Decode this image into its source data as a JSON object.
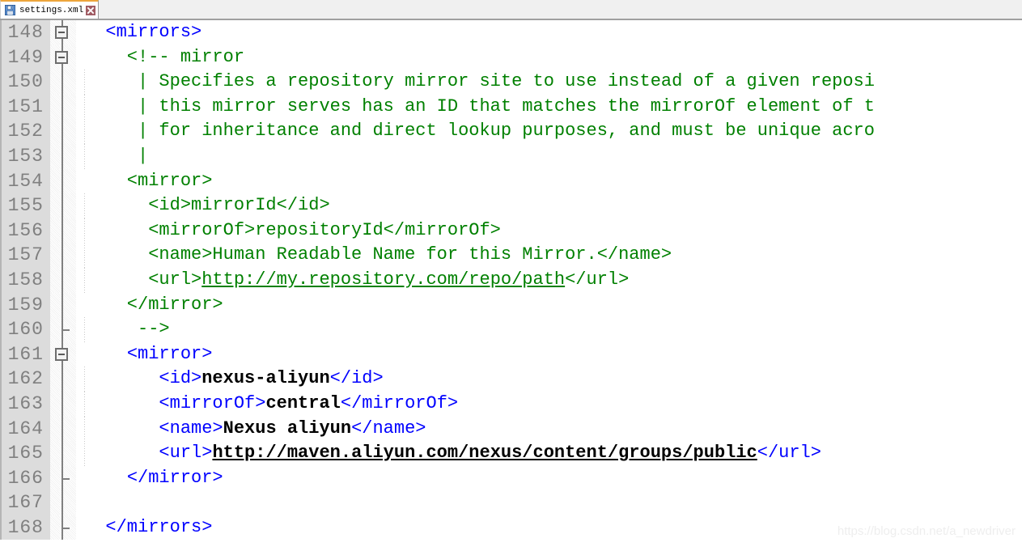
{
  "window": {
    "title": "settings.xml"
  },
  "tab": {
    "label": "settings.xml",
    "save_icon": "floppy-disk-save-icon",
    "close_icon": "close-x-icon",
    "accent_color": "#eda53c",
    "active": true
  },
  "editor": {
    "language": "xml",
    "first_visible_line": 148,
    "last_visible_line": 168,
    "colors": {
      "comment": "#008000",
      "tag": "#0000ff",
      "value": "#000000",
      "gutter_bg": "#dcdcdc",
      "gutter_fg": "#808080",
      "background": "#ffffff"
    },
    "lines": [
      {
        "number": "148",
        "fold": "box",
        "indent_guide": false,
        "tokens": [
          {
            "t": "  ",
            "c": "plain"
          },
          {
            "t": "<mirrors>",
            "c": "tag"
          }
        ]
      },
      {
        "number": "149",
        "fold": "box",
        "indent_guide": false,
        "tokens": [
          {
            "t": "    <!-- mirror",
            "c": "cmt"
          }
        ]
      },
      {
        "number": "150",
        "fold": "line",
        "indent_guide": true,
        "tokens": [
          {
            "t": "     | Specifies a repository mirror site to use instead of a given reposi",
            "c": "cmt"
          }
        ]
      },
      {
        "number": "151",
        "fold": "line",
        "indent_guide": true,
        "tokens": [
          {
            "t": "     | this mirror serves has an ID that matches the mirrorOf element of t",
            "c": "cmt"
          }
        ]
      },
      {
        "number": "152",
        "fold": "line",
        "indent_guide": true,
        "tokens": [
          {
            "t": "     | for inheritance and direct lookup purposes, and must be unique acro",
            "c": "cmt"
          }
        ]
      },
      {
        "number": "153",
        "fold": "line",
        "indent_guide": true,
        "tokens": [
          {
            "t": "     |",
            "c": "cmt"
          }
        ]
      },
      {
        "number": "154",
        "fold": "line",
        "indent_guide": false,
        "tokens": [
          {
            "t": "    <mirror>",
            "c": "cmt"
          }
        ]
      },
      {
        "number": "155",
        "fold": "line",
        "indent_guide": true,
        "tokens": [
          {
            "t": "      <id>mirrorId</id>",
            "c": "cmt"
          }
        ]
      },
      {
        "number": "156",
        "fold": "line",
        "indent_guide": true,
        "tokens": [
          {
            "t": "      <mirrorOf>repositoryId</mirrorOf>",
            "c": "cmt"
          }
        ]
      },
      {
        "number": "157",
        "fold": "line",
        "indent_guide": true,
        "tokens": [
          {
            "t": "      <name>Human Readable Name for this Mirror.</name>",
            "c": "cmt"
          }
        ]
      },
      {
        "number": "158",
        "fold": "line",
        "indent_guide": true,
        "tokens": [
          {
            "t": "      <url>",
            "c": "cmt"
          },
          {
            "t": "http://my.repository.com/repo/path",
            "c": "cmt-u"
          },
          {
            "t": "</url>",
            "c": "cmt"
          }
        ]
      },
      {
        "number": "159",
        "fold": "line",
        "indent_guide": false,
        "tokens": [
          {
            "t": "    </mirror>",
            "c": "cmt"
          }
        ]
      },
      {
        "number": "160",
        "fold": "endtick",
        "indent_guide": true,
        "tokens": [
          {
            "t": "     -->",
            "c": "cmt"
          }
        ]
      },
      {
        "number": "161",
        "fold": "box",
        "indent_guide": false,
        "tokens": [
          {
            "t": "    ",
            "c": "plain"
          },
          {
            "t": "<mirror>",
            "c": "tag"
          }
        ]
      },
      {
        "number": "162",
        "fold": "line",
        "indent_guide": true,
        "tokens": [
          {
            "t": "       ",
            "c": "plain"
          },
          {
            "t": "<id>",
            "c": "tag"
          },
          {
            "t": "nexus-aliyun",
            "c": "val"
          },
          {
            "t": "</id>",
            "c": "tag"
          }
        ]
      },
      {
        "number": "163",
        "fold": "line",
        "indent_guide": true,
        "tokens": [
          {
            "t": "       ",
            "c": "plain"
          },
          {
            "t": "<mirrorOf>",
            "c": "tag"
          },
          {
            "t": "central",
            "c": "val"
          },
          {
            "t": "</mirrorOf>",
            "c": "tag"
          }
        ]
      },
      {
        "number": "164",
        "fold": "line",
        "indent_guide": true,
        "tokens": [
          {
            "t": "       ",
            "c": "plain"
          },
          {
            "t": "<name>",
            "c": "tag"
          },
          {
            "t": "Nexus aliyun",
            "c": "val"
          },
          {
            "t": "</name>",
            "c": "tag"
          }
        ]
      },
      {
        "number": "165",
        "fold": "line",
        "indent_guide": true,
        "tokens": [
          {
            "t": "       ",
            "c": "plain"
          },
          {
            "t": "<url>",
            "c": "tag"
          },
          {
            "t": "http://maven.aliyun.com/nexus/content/groups/public",
            "c": "val-u"
          },
          {
            "t": "</url>",
            "c": "tag"
          }
        ]
      },
      {
        "number": "166",
        "fold": "endtick",
        "indent_guide": false,
        "tokens": [
          {
            "t": "    ",
            "c": "plain"
          },
          {
            "t": "</mirror>",
            "c": "tag"
          }
        ]
      },
      {
        "number": "167",
        "fold": "line",
        "indent_guide": false,
        "tokens": []
      },
      {
        "number": "168",
        "fold": "endtick",
        "indent_guide": false,
        "tokens": [
          {
            "t": "  ",
            "c": "plain"
          },
          {
            "t": "</mirrors>",
            "c": "tag"
          }
        ]
      }
    ]
  },
  "watermark": {
    "text": "https://blog.csdn.net/a_newdriver"
  }
}
